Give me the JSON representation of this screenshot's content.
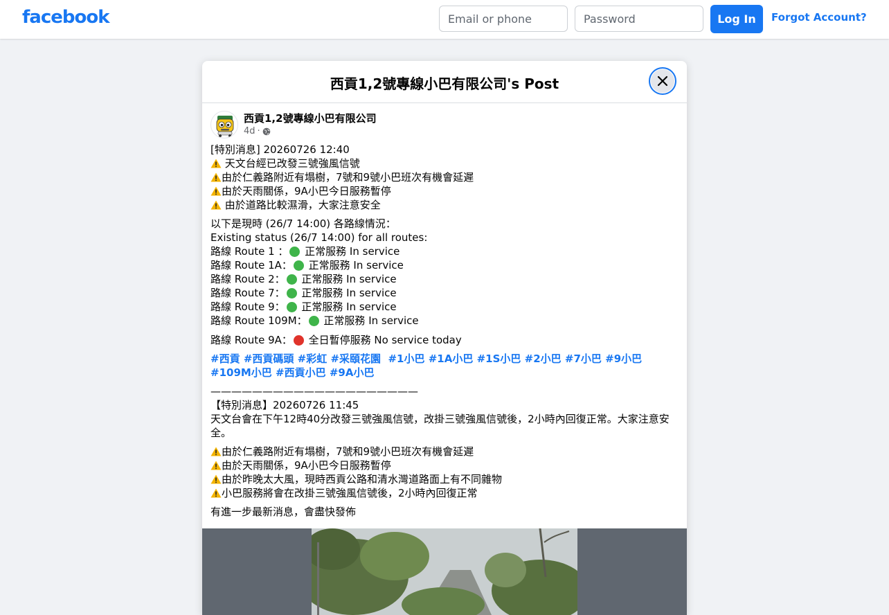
{
  "header": {
    "logo": "facebook",
    "email_placeholder": "Email or phone",
    "password_placeholder": "Password",
    "login_label": "Log In",
    "forgot_label": "Forgot Account?"
  },
  "modal": {
    "title": "西貢1,2號專線小巴有限公司's Post"
  },
  "post": {
    "page_name": "西貢1,2號專線小巴有限公司",
    "age": "4d",
    "separator": "·",
    "privacy_icon": "globe-icon",
    "block1": [
      "[特別消息] 20260726 12:40",
      " 天文台經已改發三號強風信號",
      "由於仁義路附近有塌樹，7號和9號小巴班次有機會延遲",
      "由於天雨關係，9A小巴今日服務暫停",
      " 由於道路比較濕滑，大家注意安全"
    ],
    "status_intro_zh": "以下是現時 (26/7 14:00) 各路線情況：",
    "status_intro_en": "Existing status (26/7 14:00) for all routes:",
    "routes": [
      {
        "label": "路線 Route 1 ：",
        "status": " 正常服務 In service",
        "color": "green"
      },
      {
        "label": "路線 Route 1A：",
        "status": " 正常服務 In service",
        "color": "green"
      },
      {
        "label": "路線 Route 2：",
        "status": " 正常服務 In service",
        "color": "green"
      },
      {
        "label": "路線 Route 7：",
        "status": " 正常服務 In service",
        "color": "green"
      },
      {
        "label": "路線 Route 9：",
        "status": " 正常服務 In service",
        "color": "green"
      },
      {
        "label": "路線 Route 109M：",
        "status": " 正常服務 In service",
        "color": "green"
      }
    ],
    "route_9a": {
      "label": "路線 Route 9A：",
      "status": " 全日暫停服務 No service today",
      "color": "red"
    },
    "hashtags": [
      "#西貢",
      "#西貢碼頭",
      "#彩虹",
      "#采頤花園",
      "#1小巴",
      "#1A小巴",
      "#1S小巴",
      "#2小巴",
      "#7小巴",
      "#9小巴",
      "#109M小巴",
      "#西貢小巴",
      "#9A小巴"
    ],
    "divider": "————————————————————",
    "block2_title": "【特別消息】20260726 11:45",
    "block2_text": "天文台會在下午12時40分改發三號強風信號，改掛三號強風信號後，2小時內回復正常。大家注意安全。",
    "block2_items": [
      "由於仁義路附近有塌樹，7號和9號小巴班次有機會延遲",
      "由於天雨關係，9A小巴今日服務暫停",
      "由於昨晚太大風，現時西貢公路和清水灣道路面上有不同雜物",
      "小巴服務將會在改掛三號強風信號後，2小時內回復正常"
    ],
    "closing": "有進一步最新消息，會盡快發佈"
  },
  "colors": {
    "brand": "#1877f2",
    "in_service": "#3fb44a",
    "no_service": "#e0332b",
    "warning": "#f4b400"
  }
}
